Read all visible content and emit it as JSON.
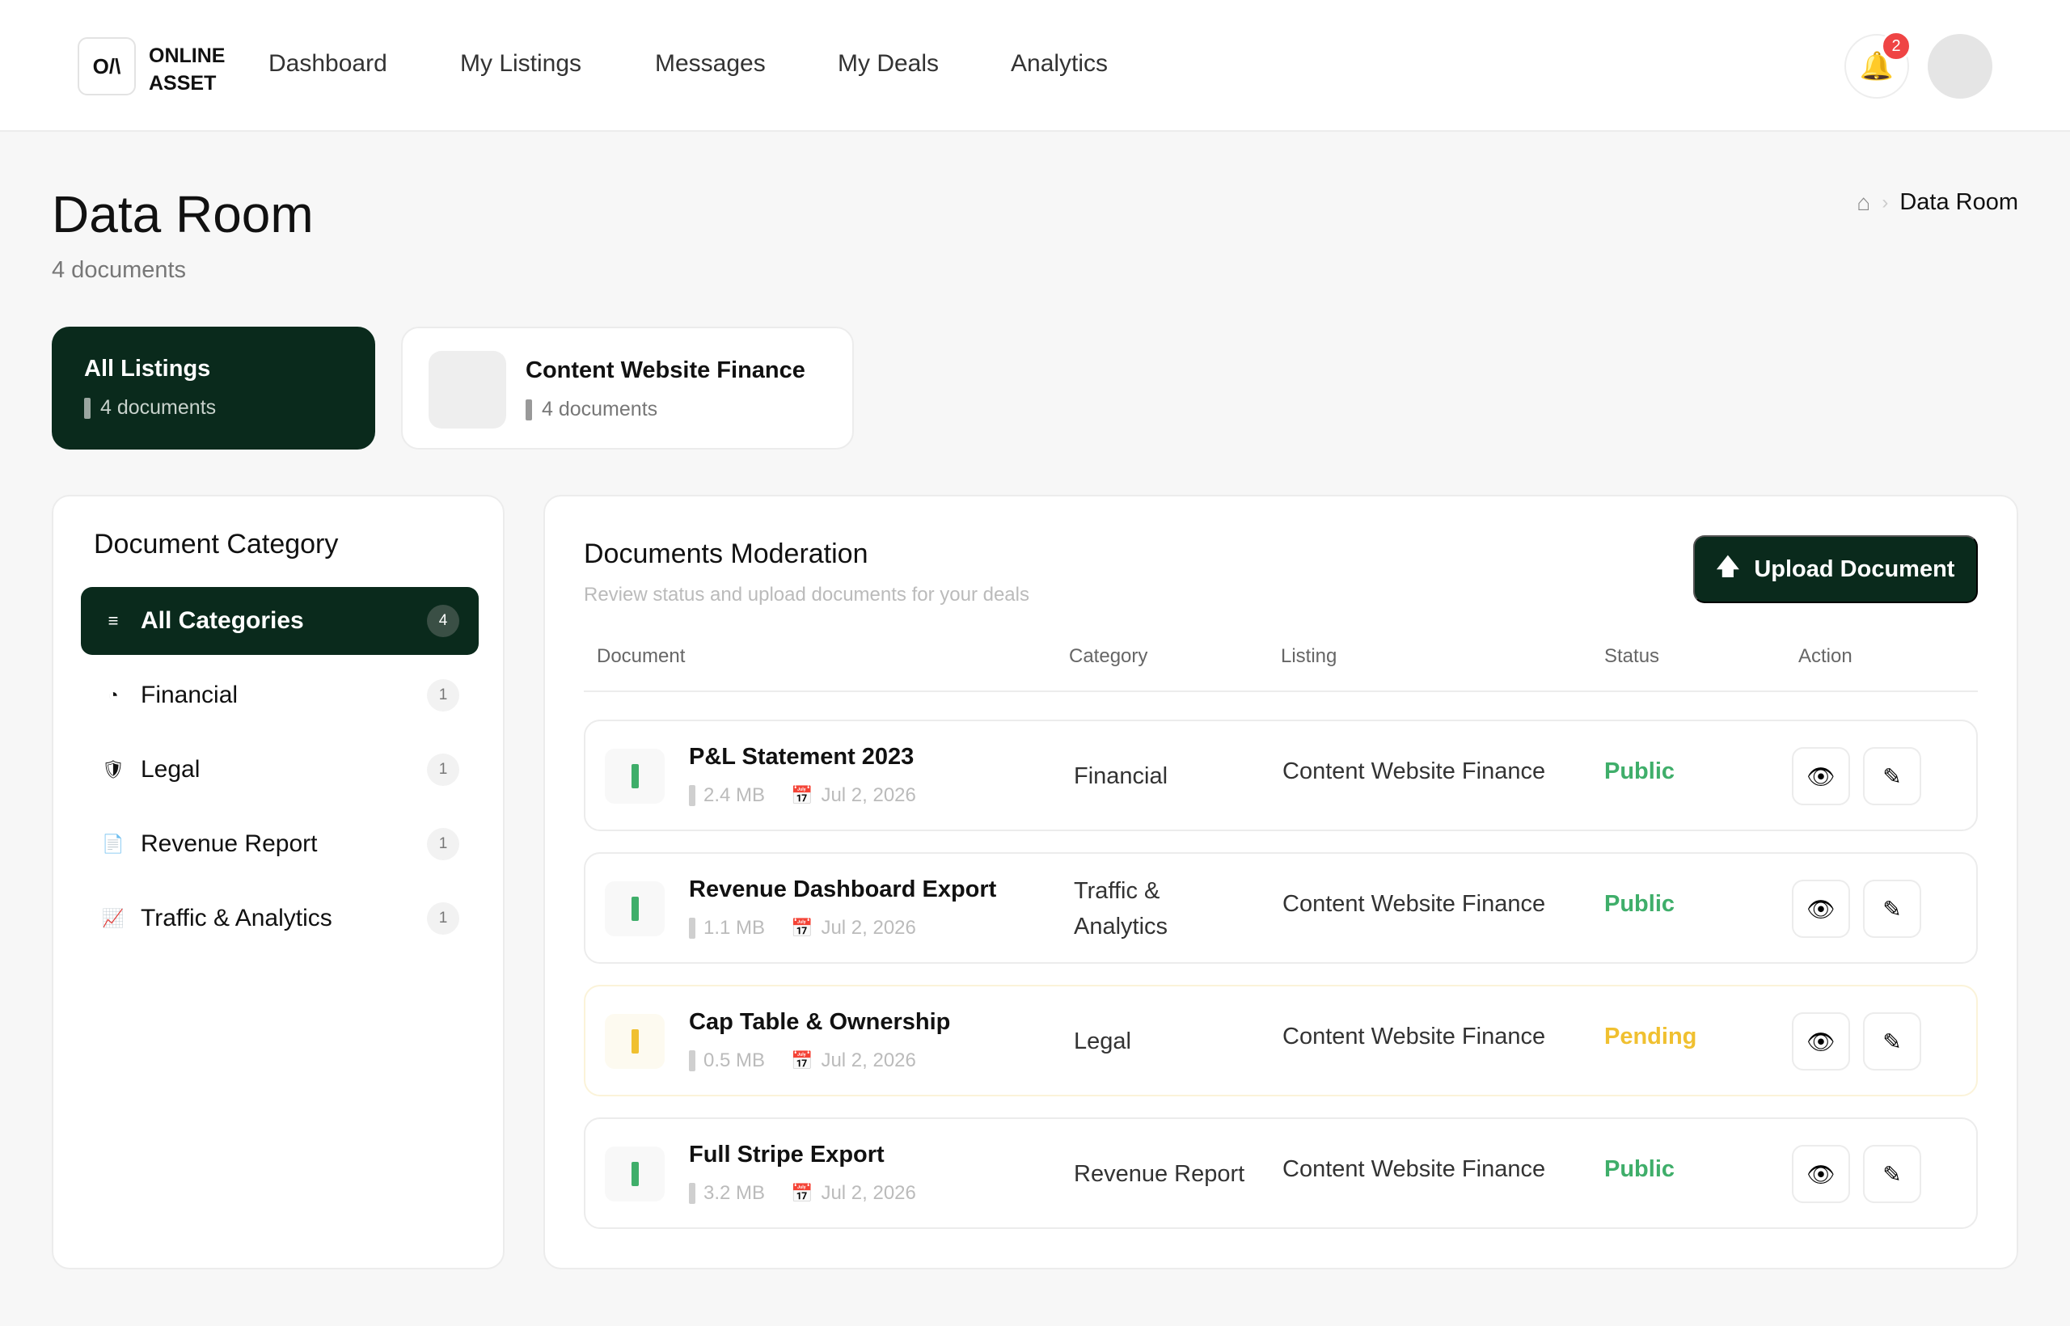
{
  "brand": {
    "mark": "O/\\",
    "line1": "ONLINE",
    "line2": "ASSET"
  },
  "nav": [
    {
      "label": "Dashboard"
    },
    {
      "label": "My Listings"
    },
    {
      "label": "Messages"
    },
    {
      "label": "My Deals"
    },
    {
      "label": "Analytics"
    }
  ],
  "notifications": {
    "count": "2",
    "icon": "bell-icon"
  },
  "page": {
    "title": "Data Room",
    "subtitle": "4 documents"
  },
  "breadcrumb": {
    "home_icon": "⌂",
    "separator": "›",
    "current": "Data Room"
  },
  "listings": [
    {
      "title": "All Listings",
      "count": "4 documents"
    },
    {
      "title": "Content Website Finance",
      "count": "4 documents"
    }
  ],
  "categories": {
    "title": "Document Category",
    "items": [
      {
        "icon": "≡",
        "label": "All Categories",
        "count": "4"
      },
      {
        "icon": "◔",
        "label": "Financial",
        "count": "1"
      },
      {
        "icon": "🛡",
        "label": "Legal",
        "count": "1"
      },
      {
        "icon": "📄",
        "label": "Revenue Report",
        "count": "1"
      },
      {
        "icon": "📈",
        "label": "Traffic & Analytics",
        "count": "1"
      }
    ]
  },
  "documents": {
    "title": "Documents Moderation",
    "subtitle": "Review status and upload documents for your deals",
    "upload_label": "Upload Document",
    "columns": [
      "Document",
      "Category",
      "Listing",
      "Status",
      "Action"
    ],
    "rows": [
      {
        "name": "P&L Statement 2023",
        "size": "2.4 MB",
        "date": "Jul 2, 2026",
        "category": "Financial",
        "listing": "Content Website Finance",
        "status": "Public"
      },
      {
        "name": "Revenue Dashboard Export",
        "size": "1.1 MB",
        "date": "Jul 2, 2026",
        "category": "Traffic & Analytics",
        "listing": "Content Website Finance",
        "status": "Public"
      },
      {
        "name": "Cap Table & Ownership",
        "size": "0.5 MB",
        "date": "Jul 2, 2026",
        "category": "Legal",
        "listing": "Content Website Finance",
        "status": "Pending"
      },
      {
        "name": "Full Stripe Export",
        "size": "3.2 MB",
        "date": "Jul 2, 2026",
        "category": "Revenue Report",
        "listing": "Content Website Finance",
        "status": "Public"
      }
    ]
  },
  "colors": {
    "brand_dark": "#0a2a1c",
    "public": "#3fae6a",
    "pending": "#f0c030",
    "badge": "#ef4444"
  },
  "icons": {
    "view": "eye-icon",
    "edit": "pencil-icon",
    "upload": "upload-arrow-icon",
    "calendar": "calendar-icon"
  }
}
